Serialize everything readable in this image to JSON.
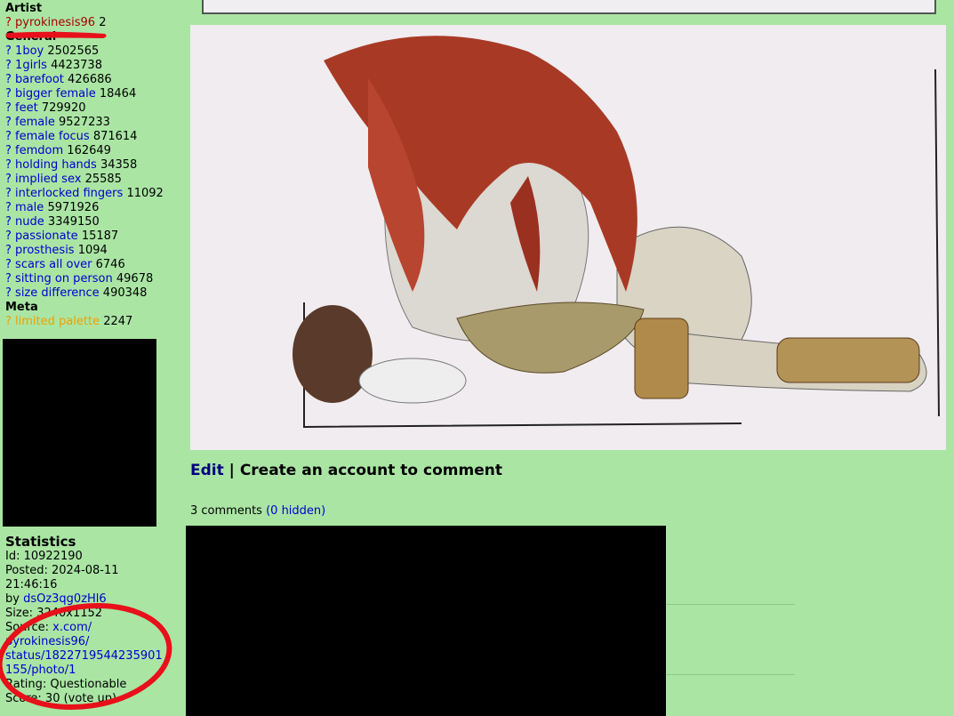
{
  "sidebar": {
    "artist_heading": "Artist",
    "artist_tags": [
      {
        "q": "?",
        "name": "pyrokinesis96",
        "count": "2"
      }
    ],
    "general_heading": "General",
    "general_tags": [
      {
        "q": "?",
        "name": "1boy",
        "count": "2502565"
      },
      {
        "q": "?",
        "name": "1girls",
        "count": "4423738"
      },
      {
        "q": "?",
        "name": "barefoot",
        "count": "426686"
      },
      {
        "q": "?",
        "name": "bigger female",
        "count": "18464"
      },
      {
        "q": "?",
        "name": "feet",
        "count": "729920"
      },
      {
        "q": "?",
        "name": "female",
        "count": "9527233"
      },
      {
        "q": "?",
        "name": "female focus",
        "count": "871614"
      },
      {
        "q": "?",
        "name": "femdom",
        "count": "162649"
      },
      {
        "q": "?",
        "name": "holding hands",
        "count": "34358"
      },
      {
        "q": "?",
        "name": "implied sex",
        "count": "25585"
      },
      {
        "q": "?",
        "name": "interlocked fingers",
        "count": "11092"
      },
      {
        "q": "?",
        "name": "male",
        "count": "5971926"
      },
      {
        "q": "?",
        "name": "nude",
        "count": "3349150"
      },
      {
        "q": "?",
        "name": "passionate",
        "count": "15187"
      },
      {
        "q": "?",
        "name": "prosthesis",
        "count": "1094"
      },
      {
        "q": "?",
        "name": "scars all over",
        "count": "6746"
      },
      {
        "q": "?",
        "name": "sitting on person",
        "count": "49678"
      },
      {
        "q": "?",
        "name": "size difference",
        "count": "490348"
      }
    ],
    "meta_heading": "Meta",
    "meta_tags": [
      {
        "q": "?",
        "name": "limited palette",
        "count": "2247"
      }
    ]
  },
  "stats": {
    "heading": "Statistics",
    "id": "Id: 10922190",
    "posted": "Posted: 2024-08-11",
    "posted_time": "21:46:16",
    "by_prefix": "by ",
    "by_user": "dsOz3qg0zHl6",
    "size": "Size: 3240x1152",
    "source_prefix": "Source: ",
    "source_lines": [
      "x.com/",
      "pyrokinesis96/",
      "status/1822719544235901",
      "155/photo/1"
    ],
    "rating": "Rating: Questionable",
    "score": "Score: 30 (vote up)"
  },
  "main": {
    "edit_label": "Edit",
    "separator": "|",
    "comment_label": "Create an account to comment",
    "comments_count": "3 comments",
    "hidden_label": "(0 hidden)"
  },
  "colors": {
    "background": "#aae5a4",
    "artist_tag": "#aa0000",
    "general_tag": "#0000cc",
    "meta_tag": "#f0a000",
    "annotation": "#e8101a"
  }
}
